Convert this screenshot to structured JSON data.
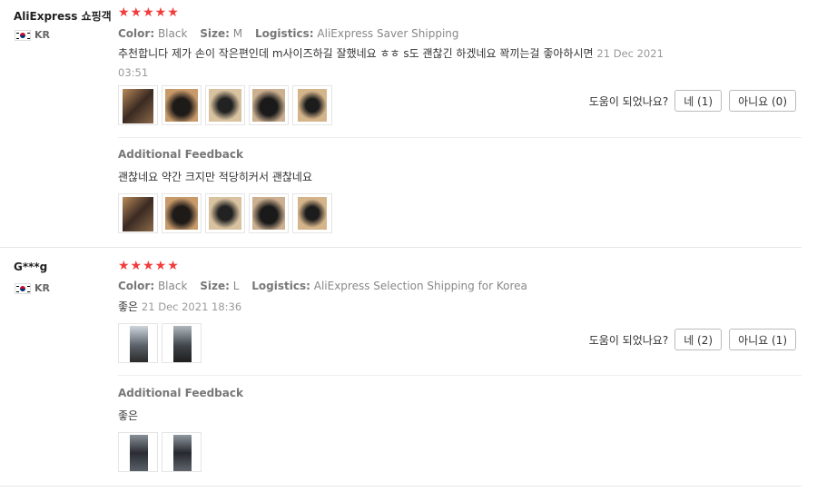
{
  "reviews": [
    {
      "user": "AliExpress 쇼핑객",
      "country": "KR",
      "stars": "★★★★★",
      "color_label": "Color:",
      "color": "Black",
      "size_label": "Size:",
      "size": "M",
      "logistics_label": "Logistics:",
      "logistics": "AliExpress Saver Shipping",
      "text": "추천합니다 제가 손이 작은편인데 m사이즈하길 잘했네요 ㅎㅎ s도 괜찮긴 하겠네요 꽉끼는걸 좋아하시면",
      "date_part1": "21 Dec 2021",
      "date_part2": "03:51",
      "helpful_label": "도움이 되었나요?",
      "yes": "네 (1)",
      "no": "아니요 (0)",
      "additional_label": "Additional Feedback",
      "additional_text": "괜찮네요 약간 크지만 적당히커서 괜찮네요"
    },
    {
      "user": "G***g",
      "country": "KR",
      "stars": "★★★★★",
      "color_label": "Color:",
      "color": "Black",
      "size_label": "Size:",
      "size": "L",
      "logistics_label": "Logistics:",
      "logistics": "AliExpress Selection Shipping for Korea",
      "text": "좋은",
      "date": "21 Dec 2021 18:36",
      "helpful_label": "도움이 되었나요?",
      "yes": "네 (2)",
      "no": "아니요 (1)",
      "additional_label": "Additional Feedback",
      "additional_text": "좋은"
    }
  ],
  "colors": {
    "star": "#f23b3b",
    "meta": "#888888",
    "border": "#bbbbbb"
  }
}
